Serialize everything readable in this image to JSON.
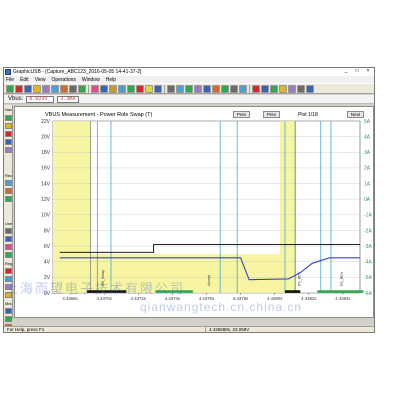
{
  "window": {
    "title": "GraphicUSB - [Capture_ABC123_2016-05-05 14-41-37-2]",
    "controls": [
      "_",
      "□",
      "×"
    ]
  },
  "menu": [
    "File",
    "Edit",
    "View",
    "Operations",
    "Window",
    "Help"
  ],
  "toolbar": {
    "button_colors": [
      "#2fa84f",
      "#d9262c",
      "#3a63b8",
      "#e0b620",
      "#9a7cc4",
      "#4a9fd9",
      "#d16a2a",
      "#6b6b6b",
      "#2fa84f",
      "#e24a8a",
      "#3a63b8",
      "#c69c2b",
      "#4a9fd9",
      "#2fa84f",
      "#d9262c",
      "#d9d940",
      "#3a63b8",
      "#6b6b6b",
      "#4a9fd9",
      "#2fa84f",
      "#9a7cc4",
      "#3a63b8",
      "#d16a2a",
      "#2fa84f",
      "#6b6b6b",
      "#4a9fd9",
      "#d9262c",
      "#3a63b8",
      "#2fa84f",
      "#e0b620",
      "#9a7cc4",
      "#6b6b6b",
      "#3a63b8"
    ]
  },
  "vbus": {
    "label": "Vbus:",
    "voltage": "0.023V",
    "current": "3.3mA"
  },
  "sidebar": {
    "labels": [
      "Nav",
      "Rec",
      "Use",
      "Reg",
      "Mrk"
    ],
    "button_colors": [
      "#2fa84f",
      "#e0b620",
      "#d9262c",
      "#3a63b8",
      "#9a7cc4",
      "#4a9fd9",
      "#d16a2a",
      "#2fa84f",
      "#6b6b6b",
      "#3a63b8",
      "#e24a8a",
      "#2fa84f",
      "#d9262c",
      "#4a9fd9",
      "#9a7cc4",
      "#e0b620",
      "#3a63b8",
      "#2fa84f",
      "#d16a2a"
    ]
  },
  "plot": {
    "title": "VBUS Measurement - Power Role Swap (T)",
    "prev_label": "Prev",
    "prev2_label": "Prev",
    "next_label": "Next",
    "page": "Plot 1/18"
  },
  "status": {
    "left": "For Help, press F1",
    "right": "4.435688s, 23.058V"
  },
  "watermark": {
    "cn": "上海而望电子技术有限公司",
    "en": "qianwangtech.cn.china.cn"
  },
  "chart_data": {
    "type": "line",
    "title": "VBUS Measurement - Power Role Swap (T)",
    "yaxis_left": {
      "ticks": [
        "22V",
        "20V",
        "18V",
        "16V",
        "14V",
        "12V",
        "10V",
        "8V",
        "6V",
        "4V",
        "2V",
        "0V"
      ],
      "range": [
        0,
        22
      ]
    },
    "yaxis_right": {
      "ticks": [
        "5A",
        "4A",
        "3A",
        "2A",
        "1A",
        "0A",
        "-1A",
        "-2A",
        "-3A",
        "-4A",
        "-5A",
        "-6A"
      ],
      "range": [
        -6,
        5
      ]
    },
    "xaxis": {
      "ticks": [
        "4.4368s",
        "4.4370s",
        "4.4372s",
        "4.4374s",
        "4.4376s",
        "4.4378s",
        "4.4380s",
        "4.4382s",
        "4.4384s"
      ],
      "range": [
        4.4367,
        4.4385
      ]
    },
    "voltage_series": {
      "name": "VBUS",
      "color": "#3a44c8",
      "points": [
        [
          4.43674,
          4.5
        ],
        [
          4.4378,
          4.5
        ],
        [
          4.43785,
          1.7
        ],
        [
          4.43808,
          1.8
        ],
        [
          4.43815,
          2.6
        ],
        [
          4.43822,
          3.8
        ],
        [
          4.43832,
          4.5
        ],
        [
          4.4385,
          4.5
        ]
      ]
    },
    "current_series": {
      "name": "IBUS",
      "color": "#000000",
      "points": [
        [
          4.43674,
          5.2
        ],
        [
          4.43729,
          5.2
        ],
        [
          4.43729,
          6.2
        ],
        [
          4.4385,
          6.2
        ]
      ]
    },
    "shaded_regions_color": "#f7f5a2",
    "marker_lines_color": "#3fa9d6",
    "bar_colors": {
      "black": "#111111",
      "green": "#2fa84f"
    },
    "vertical_annotations": [
      "PR_Swap",
      "Accept",
      "PS_RDY",
      "PS_RDY"
    ]
  }
}
